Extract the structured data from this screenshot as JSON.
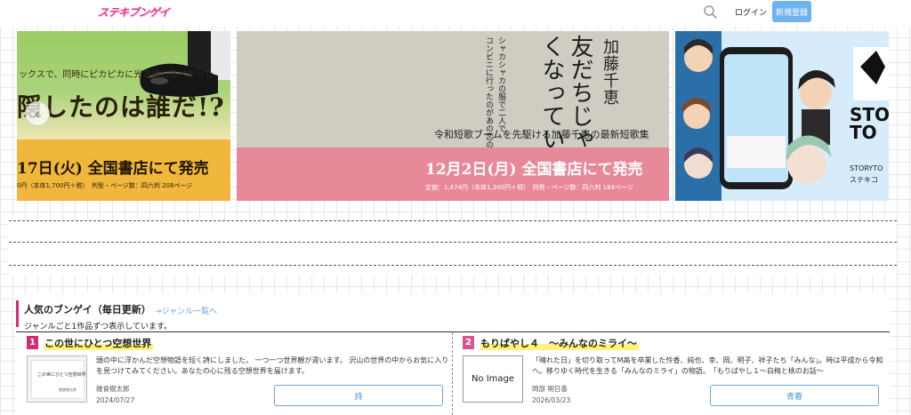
{
  "header": {
    "logo_text": "ステキブンゲイ",
    "search_icon": "search-icon",
    "login_label": "ログイン",
    "signup_label": "新規登録",
    "brand_color": "#e0328a",
    "accent_color": "#6fb3ee"
  },
  "carousel": {
    "prev_icon": "chevron-left-icon",
    "slides": [
      {
        "top_text": "ックスで、同時にピカピカに光る追しるべだった",
        "big_text": "隠したのは誰だ!?",
        "date_text": "17日(火) 全国書店にて発売",
        "price_text": "0円（本体1,700円＋税）　判型・ページ数：四六判 208ページ"
      },
      {
        "author": "加藤千恵",
        "title": "友だちじゃなくなっていく",
        "sub_line1": "シャカシャカの服で二人で",
        "sub_line2": "コンビニに行ったのがあの恋のピークだ",
        "tagline": "令和短歌ブームを先駆ける加藤千恵の最新短歌集",
        "date_text": "12月2日(月) 全国書店にて発売",
        "price_text": "定価：1,474円（本体1,340円＋税）　判型・ページ数：四六判 184ページ"
      },
      {
        "logo_line1": "STO",
        "logo_line2": "TO",
        "brand_text": "STORYTO",
        "brand_jp": "ステキコ"
      }
    ]
  },
  "popular": {
    "title": "人気のブンゲイ（毎日更新）",
    "genre_link": "→ジャンル一覧へ",
    "description": "ジャンルごと1作品ずつ表示しています。",
    "accent_color": "#d12d74",
    "cards": [
      {
        "rank": "1",
        "title": "この世にひとつ空想世界",
        "thumb_title": "この世にひとつ空想世界",
        "thumb_author": "雑食樹太郎",
        "text": "頭の中に浮かんだ空想物語を短く詩にしました。 一つ一つ世界観が違います。 沢山の世界の中からお気に入りを見つけてみてください。あなたの心に残る空想世界を届けます。",
        "author": "雑食樹太郎",
        "date": "2024/07/27",
        "genre": "詩"
      },
      {
        "rank": "2",
        "title": "もりばやし４　〜みんなのミライ〜",
        "no_image": "No Image",
        "text": "「晴れた日」を切り取ってM高を卒業した怜香、純也、幸、岡、明子、祥子たち「みんな」。時は平成から令和へ。移りゆく時代を生きる「みんなのミライ」の物語。　「もりばやし１〜白梅と桃のお話〜",
        "author": "岡部 明日香",
        "date": "2026/03/23",
        "genre": "青春"
      }
    ]
  }
}
